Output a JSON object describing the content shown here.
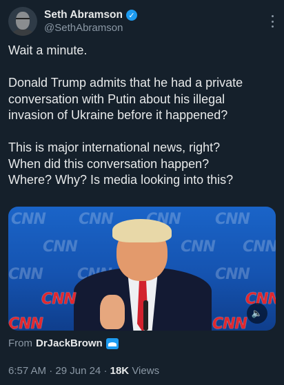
{
  "author": {
    "name": "Seth Abramson",
    "handle": "@SethAbramson",
    "verified_mark": "✓"
  },
  "tweet": {
    "lines": [
      "Wait a minute.",
      "",
      "Donald Trump admits that he had a private",
      "conversation with Putin about his illegal",
      "invasion of Ukraine before it happened?",
      "",
      "This is major international news, right?",
      "When did this conversation happen?",
      "Where? Why? Is media looking into this?"
    ]
  },
  "media": {
    "watermark": "CNN",
    "mute_icon": "🔈"
  },
  "source": {
    "prefix": "From",
    "user": "DrJackBrown"
  },
  "meta": {
    "time": "6:57 AM",
    "date": "29 Jun 24",
    "separator": "·",
    "views_count": "18K",
    "views_label": "Views"
  },
  "colors": {
    "background": "#15202b",
    "accent": "#1d9bf0",
    "secondary_text": "#8b98a5"
  }
}
